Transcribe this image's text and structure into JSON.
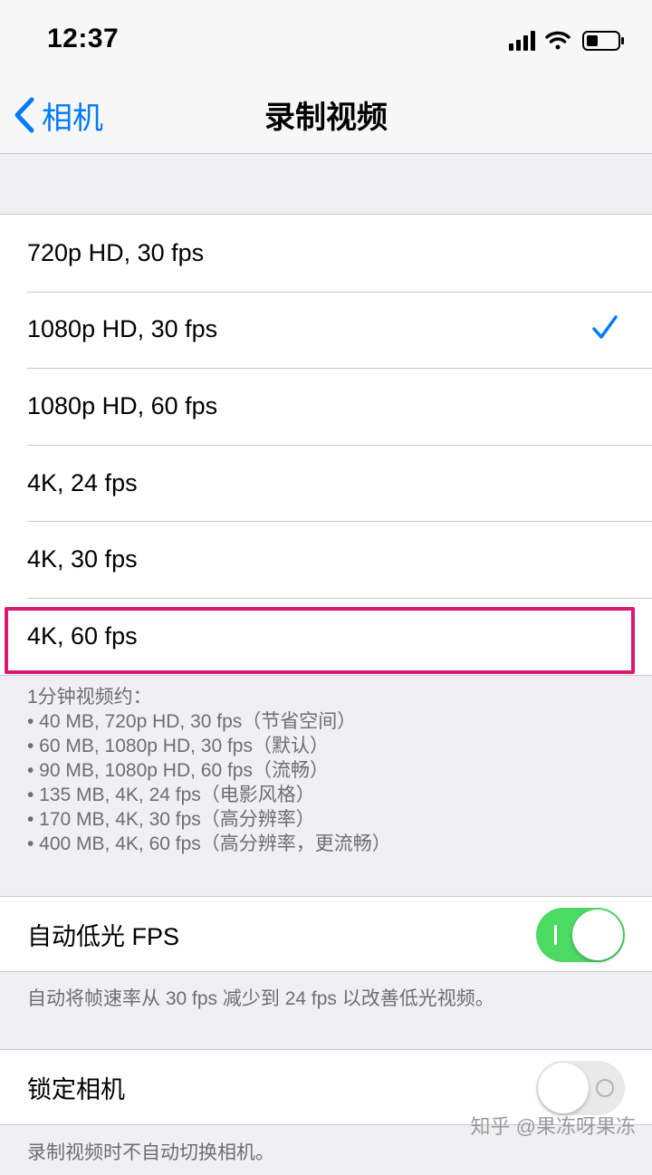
{
  "status_bar": {
    "time": "12:37",
    "icons": [
      "signal-icon",
      "wifi-icon",
      "battery-icon"
    ]
  },
  "nav": {
    "back_label": "相机",
    "title": "录制视频"
  },
  "accent_color": "#007aff",
  "options": [
    {
      "label": "720p HD, 30 fps",
      "selected": false
    },
    {
      "label": "1080p HD, 30 fps",
      "selected": true
    },
    {
      "label": "1080p HD, 60 fps",
      "selected": false
    },
    {
      "label": "4K, 24 fps",
      "selected": false
    },
    {
      "label": "4K, 30 fps",
      "selected": false
    },
    {
      "label": "4K, 60 fps",
      "selected": false
    }
  ],
  "highlight_color": "#d81b72",
  "size_note": {
    "heading": "1分钟视频约：",
    "lines": [
      "• 40 MB, 720p HD, 30 fps（节省空间）",
      "• 60 MB, 1080p HD, 30 fps（默认）",
      "• 90 MB, 1080p HD, 60 fps（流畅）",
      "• 135 MB, 4K, 24 fps（电影风格）",
      "• 170 MB, 4K, 30 fps（高分辨率）",
      "• 400 MB, 4K, 60 fps（高分辨率，更流畅）"
    ]
  },
  "auto_low_light": {
    "label": "自动低光 FPS",
    "on": true,
    "note": "自动将帧速率从 30 fps 减少到 24 fps 以改善低光视频。"
  },
  "lock_camera": {
    "label": "锁定相机",
    "on": false,
    "note": "录制视频时不自动切换相机。"
  },
  "watermark": "知乎 @果冻呀果冻"
}
